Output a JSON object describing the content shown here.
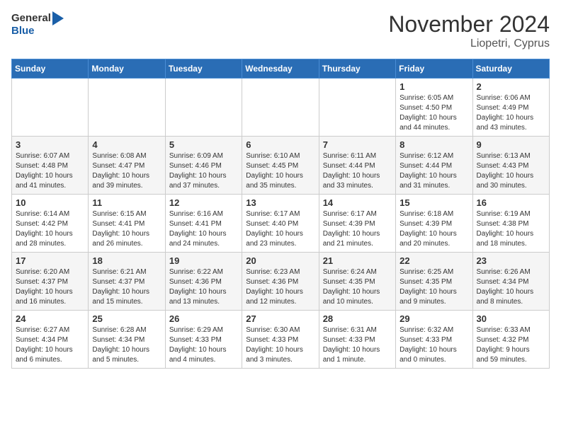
{
  "header": {
    "logo_general": "General",
    "logo_blue": "Blue",
    "month_year": "November 2024",
    "location": "Liopetri, Cyprus"
  },
  "weekdays": [
    "Sunday",
    "Monday",
    "Tuesday",
    "Wednesday",
    "Thursday",
    "Friday",
    "Saturday"
  ],
  "weeks": [
    [
      {
        "day": "",
        "info": ""
      },
      {
        "day": "",
        "info": ""
      },
      {
        "day": "",
        "info": ""
      },
      {
        "day": "",
        "info": ""
      },
      {
        "day": "",
        "info": ""
      },
      {
        "day": "1",
        "info": "Sunrise: 6:05 AM\nSunset: 4:50 PM\nDaylight: 10 hours\nand 44 minutes."
      },
      {
        "day": "2",
        "info": "Sunrise: 6:06 AM\nSunset: 4:49 PM\nDaylight: 10 hours\nand 43 minutes."
      }
    ],
    [
      {
        "day": "3",
        "info": "Sunrise: 6:07 AM\nSunset: 4:48 PM\nDaylight: 10 hours\nand 41 minutes."
      },
      {
        "day": "4",
        "info": "Sunrise: 6:08 AM\nSunset: 4:47 PM\nDaylight: 10 hours\nand 39 minutes."
      },
      {
        "day": "5",
        "info": "Sunrise: 6:09 AM\nSunset: 4:46 PM\nDaylight: 10 hours\nand 37 minutes."
      },
      {
        "day": "6",
        "info": "Sunrise: 6:10 AM\nSunset: 4:45 PM\nDaylight: 10 hours\nand 35 minutes."
      },
      {
        "day": "7",
        "info": "Sunrise: 6:11 AM\nSunset: 4:44 PM\nDaylight: 10 hours\nand 33 minutes."
      },
      {
        "day": "8",
        "info": "Sunrise: 6:12 AM\nSunset: 4:44 PM\nDaylight: 10 hours\nand 31 minutes."
      },
      {
        "day": "9",
        "info": "Sunrise: 6:13 AM\nSunset: 4:43 PM\nDaylight: 10 hours\nand 30 minutes."
      }
    ],
    [
      {
        "day": "10",
        "info": "Sunrise: 6:14 AM\nSunset: 4:42 PM\nDaylight: 10 hours\nand 28 minutes."
      },
      {
        "day": "11",
        "info": "Sunrise: 6:15 AM\nSunset: 4:41 PM\nDaylight: 10 hours\nand 26 minutes."
      },
      {
        "day": "12",
        "info": "Sunrise: 6:16 AM\nSunset: 4:41 PM\nDaylight: 10 hours\nand 24 minutes."
      },
      {
        "day": "13",
        "info": "Sunrise: 6:17 AM\nSunset: 4:40 PM\nDaylight: 10 hours\nand 23 minutes."
      },
      {
        "day": "14",
        "info": "Sunrise: 6:17 AM\nSunset: 4:39 PM\nDaylight: 10 hours\nand 21 minutes."
      },
      {
        "day": "15",
        "info": "Sunrise: 6:18 AM\nSunset: 4:39 PM\nDaylight: 10 hours\nand 20 minutes."
      },
      {
        "day": "16",
        "info": "Sunrise: 6:19 AM\nSunset: 4:38 PM\nDaylight: 10 hours\nand 18 minutes."
      }
    ],
    [
      {
        "day": "17",
        "info": "Sunrise: 6:20 AM\nSunset: 4:37 PM\nDaylight: 10 hours\nand 16 minutes."
      },
      {
        "day": "18",
        "info": "Sunrise: 6:21 AM\nSunset: 4:37 PM\nDaylight: 10 hours\nand 15 minutes."
      },
      {
        "day": "19",
        "info": "Sunrise: 6:22 AM\nSunset: 4:36 PM\nDaylight: 10 hours\nand 13 minutes."
      },
      {
        "day": "20",
        "info": "Sunrise: 6:23 AM\nSunset: 4:36 PM\nDaylight: 10 hours\nand 12 minutes."
      },
      {
        "day": "21",
        "info": "Sunrise: 6:24 AM\nSunset: 4:35 PM\nDaylight: 10 hours\nand 10 minutes."
      },
      {
        "day": "22",
        "info": "Sunrise: 6:25 AM\nSunset: 4:35 PM\nDaylight: 10 hours\nand 9 minutes."
      },
      {
        "day": "23",
        "info": "Sunrise: 6:26 AM\nSunset: 4:34 PM\nDaylight: 10 hours\nand 8 minutes."
      }
    ],
    [
      {
        "day": "24",
        "info": "Sunrise: 6:27 AM\nSunset: 4:34 PM\nDaylight: 10 hours\nand 6 minutes."
      },
      {
        "day": "25",
        "info": "Sunrise: 6:28 AM\nSunset: 4:34 PM\nDaylight: 10 hours\nand 5 minutes."
      },
      {
        "day": "26",
        "info": "Sunrise: 6:29 AM\nSunset: 4:33 PM\nDaylight: 10 hours\nand 4 minutes."
      },
      {
        "day": "27",
        "info": "Sunrise: 6:30 AM\nSunset: 4:33 PM\nDaylight: 10 hours\nand 3 minutes."
      },
      {
        "day": "28",
        "info": "Sunrise: 6:31 AM\nSunset: 4:33 PM\nDaylight: 10 hours\nand 1 minute."
      },
      {
        "day": "29",
        "info": "Sunrise: 6:32 AM\nSunset: 4:33 PM\nDaylight: 10 hours\nand 0 minutes."
      },
      {
        "day": "30",
        "info": "Sunrise: 6:33 AM\nSunset: 4:32 PM\nDaylight: 9 hours\nand 59 minutes."
      }
    ]
  ]
}
